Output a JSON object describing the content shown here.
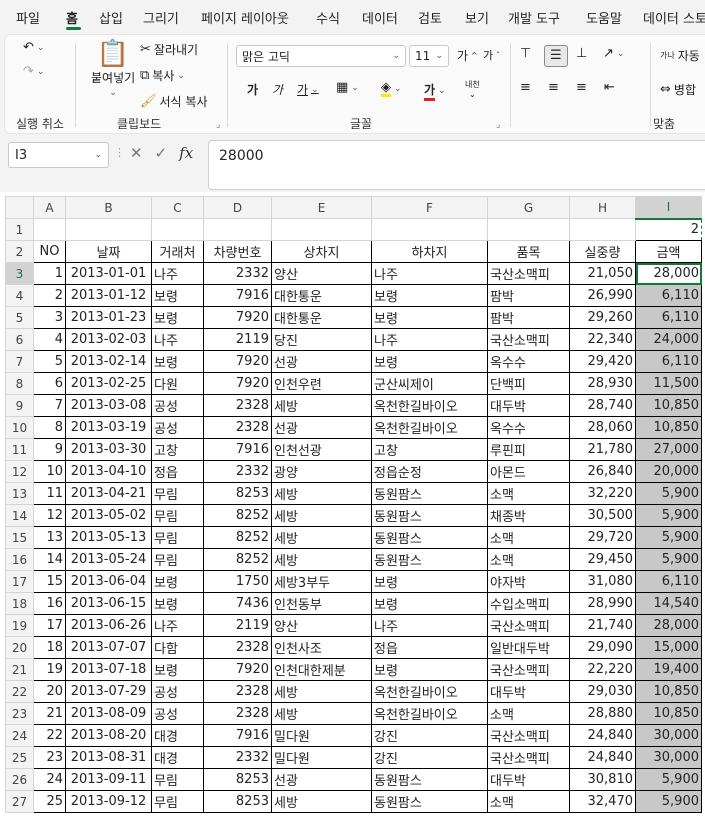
{
  "menu": [
    "파일",
    "홈",
    "삽입",
    "그리기",
    "페이지 레이아웃",
    "수식",
    "데이터",
    "검토",
    "보기",
    "개발 도구",
    "도움말",
    "데이터 스토"
  ],
  "ribbon": {
    "undo_group": "실행 취소",
    "clipboard": {
      "label": "클립보드",
      "paste": "붙여넣기",
      "cut": "잘라내기",
      "copy": "복사",
      "format_painter": "서식 복사"
    },
    "font": {
      "label": "글꼴",
      "name": "맑은 고딕",
      "size": "11",
      "bold": "가",
      "italic": "가",
      "underline": "가",
      "font_color_glyph": "가",
      "grow": "가",
      "shrink": "가",
      "phonetic": "내천"
    },
    "align": {
      "label": "맞춤",
      "wrap": "자동",
      "merge": "병합",
      "text_dir": "가나"
    }
  },
  "formula_bar": {
    "name_box": "I3",
    "fx": "fx",
    "value": "28000"
  },
  "columns": [
    "A",
    "B",
    "C",
    "D",
    "E",
    "F",
    "G",
    "H",
    "I"
  ],
  "row1_value": "2",
  "headers": [
    "NO",
    "날짜",
    "거래처",
    "차량번호",
    "상차지",
    "하차지",
    "품목",
    "실중량",
    "금액"
  ],
  "rows": [
    [
      "1",
      "2013-01-01",
      "나주",
      "2332",
      "양산",
      "나주",
      "국산소맥피",
      "21,050",
      "28,000"
    ],
    [
      "2",
      "2013-01-12",
      "보령",
      "7916",
      "대한통운",
      "보령",
      "팜박",
      "26,990",
      "6,110"
    ],
    [
      "3",
      "2013-01-23",
      "보령",
      "7920",
      "대한통운",
      "보령",
      "팜박",
      "29,260",
      "6,110"
    ],
    [
      "4",
      "2013-02-03",
      "나주",
      "2119",
      "당진",
      "나주",
      "국산소맥피",
      "22,340",
      "24,000"
    ],
    [
      "5",
      "2013-02-14",
      "보령",
      "7920",
      "선광",
      "보령",
      "옥수수",
      "29,420",
      "6,110"
    ],
    [
      "6",
      "2013-02-25",
      "다원",
      "7920",
      "인천우련",
      "군산씨제이",
      "단백피",
      "28,930",
      "11,500"
    ],
    [
      "7",
      "2013-03-08",
      "공성",
      "2328",
      "세방",
      "옥천한길바이오",
      "대두박",
      "28,740",
      "10,850"
    ],
    [
      "8",
      "2013-03-19",
      "공성",
      "2328",
      "선광",
      "옥천한길바이오",
      "옥수수",
      "28,060",
      "10,850"
    ],
    [
      "9",
      "2013-03-30",
      "고창",
      "7916",
      "인천선광",
      "고창",
      "루핀피",
      "21,780",
      "27,000"
    ],
    [
      "10",
      "2013-04-10",
      "정읍",
      "2332",
      "광양",
      "정읍순정",
      "아몬드",
      "26,840",
      "20,000"
    ],
    [
      "11",
      "2013-04-21",
      "무림",
      "8253",
      "세방",
      "동원팜스",
      "소맥",
      "32,220",
      "5,900"
    ],
    [
      "12",
      "2013-05-02",
      "무림",
      "8252",
      "세방",
      "동원팜스",
      "채종박",
      "30,500",
      "5,900"
    ],
    [
      "13",
      "2013-05-13",
      "무림",
      "8252",
      "세방",
      "동원팜스",
      "소맥",
      "29,720",
      "5,900"
    ],
    [
      "14",
      "2013-05-24",
      "무림",
      "8252",
      "세방",
      "동원팜스",
      "소맥",
      "29,450",
      "5,900"
    ],
    [
      "15",
      "2013-06-04",
      "보령",
      "1750",
      "세방3부두",
      "보령",
      "야자박",
      "31,080",
      "6,110"
    ],
    [
      "16",
      "2013-06-15",
      "보령",
      "7436",
      "인천동부",
      "보령",
      "수입소맥피",
      "28,990",
      "14,540"
    ],
    [
      "17",
      "2013-06-26",
      "나주",
      "2119",
      "양산",
      "나주",
      "국산소맥피",
      "21,740",
      "28,000"
    ],
    [
      "18",
      "2013-07-07",
      "다함",
      "2328",
      "인천사조",
      "정읍",
      "일반대두박",
      "29,090",
      "15,000"
    ],
    [
      "19",
      "2013-07-18",
      "보령",
      "7920",
      "인천대한제분",
      "보령",
      "국산소맥피",
      "22,220",
      "19,400"
    ],
    [
      "20",
      "2013-07-29",
      "공성",
      "2328",
      "세방",
      "옥천한길바이오",
      "대두박",
      "29,030",
      "10,850"
    ],
    [
      "21",
      "2013-08-09",
      "공성",
      "2328",
      "세방",
      "옥천한길바이오",
      "소맥",
      "28,880",
      "10,850"
    ],
    [
      "22",
      "2013-08-20",
      "대경",
      "7916",
      "밀다원",
      "강진",
      "국산소맥피",
      "24,840",
      "30,000"
    ],
    [
      "23",
      "2013-08-31",
      "대경",
      "2332",
      "밀다원",
      "강진",
      "국산소맥피",
      "24,840",
      "30,000"
    ],
    [
      "24",
      "2013-09-11",
      "무림",
      "8253",
      "선광",
      "동원팜스",
      "대두박",
      "30,810",
      "5,900"
    ],
    [
      "25",
      "2013-09-12",
      "무림",
      "8253",
      "세방",
      "동원팜스",
      "소맥",
      "32,470",
      "5,900"
    ]
  ]
}
